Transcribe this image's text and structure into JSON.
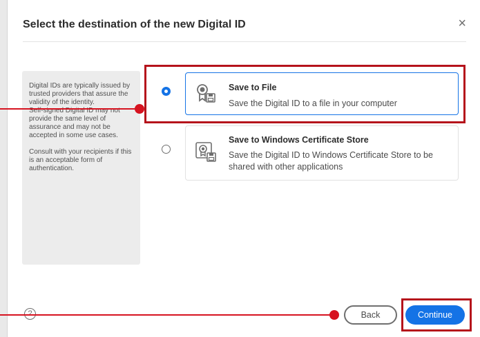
{
  "dialog": {
    "title": "Select the destination of the new Digital ID",
    "close_glyph": "×"
  },
  "info_panel": {
    "paragraph1": "Digital IDs are typically issued by trusted providers that assure the validity of the identity.",
    "paragraph2": "Self-signed Digital ID may not provide the same level of assurance and may not be accepted in some use cases.",
    "paragraph3": "Consult with your recipients if this is an acceptable form of authentication."
  },
  "options": [
    {
      "title": "Save to File",
      "description": "Save the Digital ID to a file in your computer",
      "selected": true,
      "icon": "certificate-file-icon"
    },
    {
      "title": "Save to Windows Certificate Store",
      "description": "Save the Digital ID to Windows Certificate Store to be shared with other applications",
      "selected": false,
      "icon": "certificate-store-icon"
    }
  ],
  "footer": {
    "help_glyph": "?",
    "back_label": "Back",
    "continue_label": "Continue"
  },
  "colors": {
    "accent": "#1473e6",
    "highlight": "#b5121b"
  }
}
